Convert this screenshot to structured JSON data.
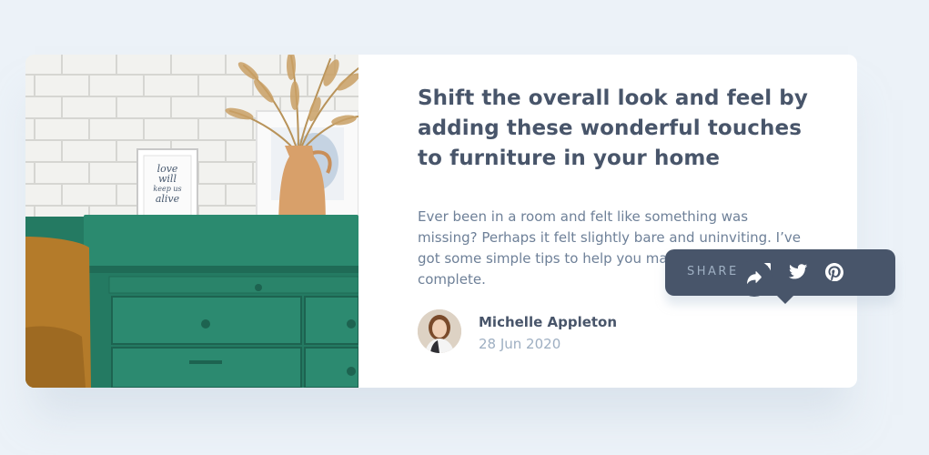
{
  "article": {
    "title": "Shift the overall look and feel by adding these wonderful touches to furniture in your home",
    "excerpt": "Ever been in a room and felt like something was missing? Perhaps it felt slightly bare and uninviting. I’ve got some simple tips to help you make any room feel complete.",
    "photo_frame_text": [
      "love",
      "will",
      "keep us",
      "alive"
    ]
  },
  "author": {
    "name": "Michelle Appleton",
    "date": "28 Jun 2020"
  },
  "share": {
    "label": "SHARE",
    "networks": [
      "facebook-icon",
      "twitter-icon",
      "pinterest-icon"
    ]
  },
  "colors": {
    "background": "#ecf2f8",
    "dark": "#48556a",
    "muted": "#9eafc2",
    "text": "#6e8098",
    "drawer_green": "#2e7d66"
  }
}
